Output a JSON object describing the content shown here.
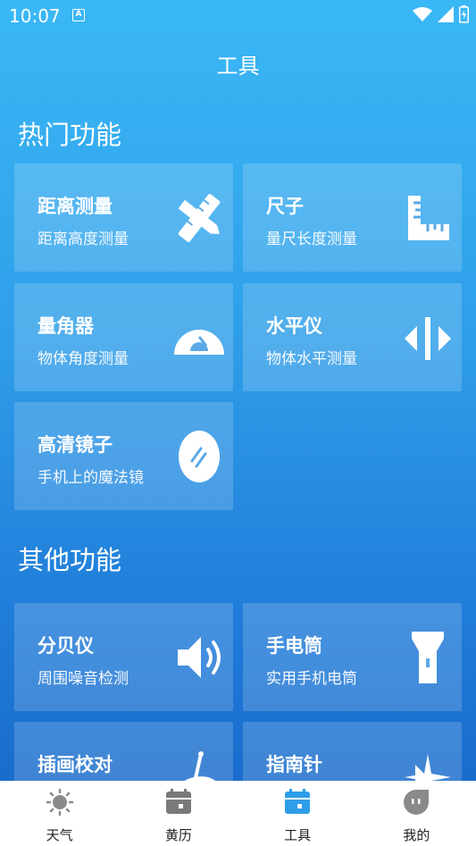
{
  "status": {
    "time": "10:07",
    "notif_glyph": "A"
  },
  "header": {
    "title": "工具"
  },
  "sections": [
    {
      "title": "热门功能",
      "cards": [
        {
          "title": "距离测量",
          "subtitle": "距离高度测量",
          "icon": "ruler-pencil-icon"
        },
        {
          "title": "尺子",
          "subtitle": "量尺长度测量",
          "icon": "l-ruler-icon"
        },
        {
          "title": "量角器",
          "subtitle": "物体角度测量",
          "icon": "protractor-icon"
        },
        {
          "title": "水平仪",
          "subtitle": "物体水平测量",
          "icon": "level-icon"
        },
        {
          "title": "高清镜子",
          "subtitle": "手机上的魔法镜",
          "icon": "mirror-icon"
        }
      ]
    },
    {
      "title": "其他功能",
      "cards": [
        {
          "title": "分贝仪",
          "subtitle": "周围噪音检测",
          "icon": "speaker-icon"
        },
        {
          "title": "手电筒",
          "subtitle": "实用手机电筒",
          "icon": "flashlight-icon"
        },
        {
          "title": "插画校对",
          "subtitle": "",
          "icon": "palette-icon"
        },
        {
          "title": "指南针",
          "subtitle": "",
          "icon": "compass-star-icon"
        }
      ]
    }
  ],
  "tabbar": {
    "active_color": "#2f9ee9",
    "tabs": [
      {
        "label": "天气",
        "icon": "sun-icon"
      },
      {
        "label": "黄历",
        "icon": "calendar-icon"
      },
      {
        "label": "工具",
        "icon": "toolbox-icon",
        "active": true
      },
      {
        "label": "我的",
        "icon": "profile-icon"
      }
    ]
  }
}
